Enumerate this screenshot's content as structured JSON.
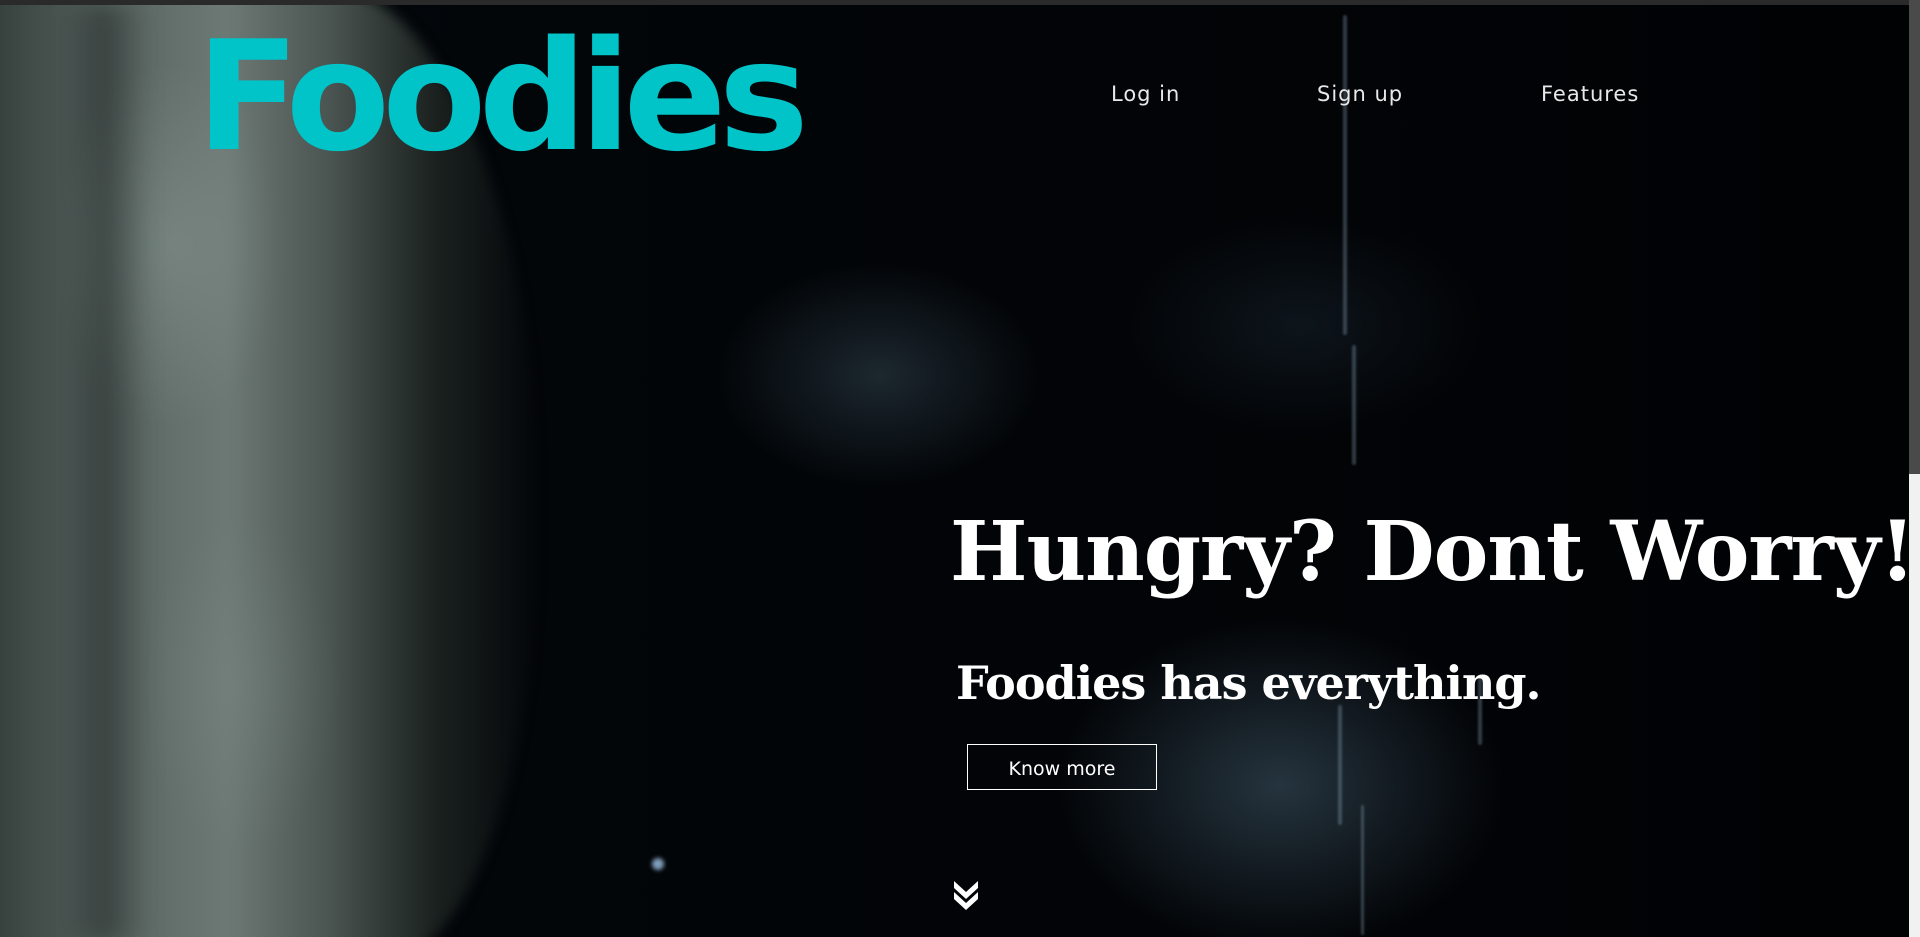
{
  "brand": {
    "logo_text": "Foodies",
    "accent_color": "#00c4c8"
  },
  "nav": {
    "items": [
      {
        "label": "Log in"
      },
      {
        "label": "Sign up"
      },
      {
        "label": "Features"
      }
    ]
  },
  "hero": {
    "headline": "Hungry? Dont Worry!",
    "subheadline": "Foodies has everything.",
    "cta_label": "Know more",
    "scroll_icon": "double-chevron-down-icon"
  },
  "scrollbar": {
    "visible_fraction": 0.5
  }
}
